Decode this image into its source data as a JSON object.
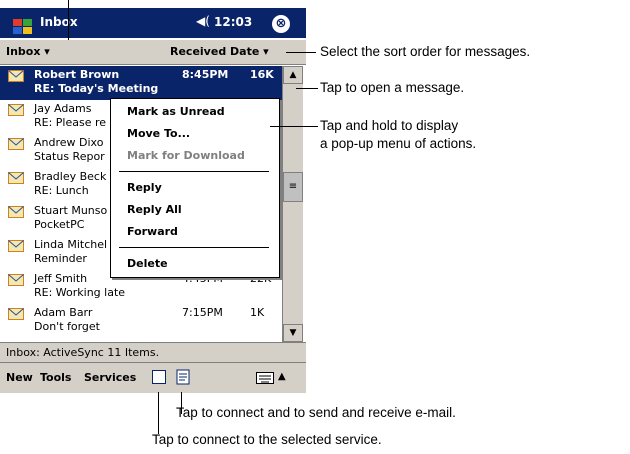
{
  "titlebar": {
    "app_title": "Inbox",
    "time": "12:03",
    "close": "⊗"
  },
  "toolbar_top": {
    "folder": "Inbox",
    "sort": "Received Date"
  },
  "messages": [
    {
      "name": "Robert Brown",
      "time": "8:45PM",
      "size": "16K",
      "subject": "RE: Today's Meeting"
    },
    {
      "name": "Jay Adams",
      "time": "",
      "size": "",
      "subject": "RE: Please re"
    },
    {
      "name": "Andrew Dixo",
      "time": "",
      "size": "",
      "subject": "Status Repor"
    },
    {
      "name": "Bradley Beck",
      "time": "",
      "size": "",
      "subject": "RE: Lunch"
    },
    {
      "name": "Stuart Munso",
      "time": "",
      "size": "",
      "subject": "PocketPC"
    },
    {
      "name": "Linda Mitchel",
      "time": "",
      "size": "",
      "subject": "Reminder"
    },
    {
      "name": "Jeff Smith",
      "time": "4:45PM",
      "size": "22K",
      "subject": "RE: Working late"
    },
    {
      "name": "Adam Barr",
      "time": "7:15PM",
      "size": "1K",
      "subject": "Don't forget"
    }
  ],
  "context_menu": {
    "items": [
      "Mark as Unread",
      "Move To...",
      "Mark for Download",
      "Reply",
      "Reply All",
      "Forward",
      "Delete"
    ]
  },
  "status": "Inbox: ActiveSync  11 Items.",
  "menubar": {
    "new": "New",
    "tools": "Tools",
    "services": "Services"
  },
  "callouts": {
    "sort": "Select the sort order for messages.",
    "open": "Tap to open a message.",
    "hold_line1": "Tap and hold to display",
    "hold_line2": "a pop-up menu of actions.",
    "send_receive": "Tap to connect and to send and receive e-mail.",
    "connect_service": "Tap to connect to the selected service."
  }
}
